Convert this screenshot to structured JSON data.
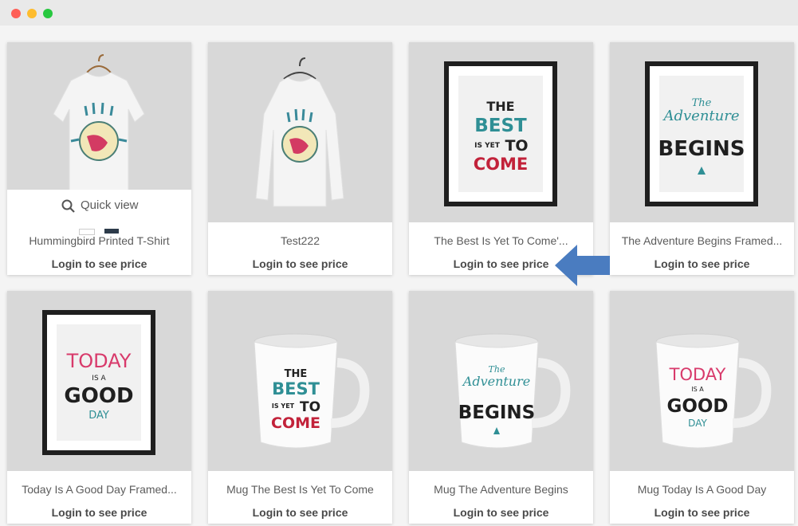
{
  "window": {
    "colors": {
      "close": "#fe5f57",
      "minimize": "#febc2e",
      "maximize": "#28c840"
    }
  },
  "quick_view": {
    "label": "Quick view",
    "icon": "search-icon"
  },
  "products": [
    {
      "name": "Hummingbird Printed T-Shirt",
      "price": "Login to see price",
      "image": "tshirt-hummingbird"
    },
    {
      "name": "Test222",
      "price": "Login to see price",
      "image": "sweater-hummingbird"
    },
    {
      "name": "The Best Is Yet To Come'...",
      "price": "Login to see price",
      "image": "poster-best-is-yet-to-come"
    },
    {
      "name": "The Adventure Begins Framed...",
      "price": "Login to see price",
      "image": "poster-adventure-begins"
    },
    {
      "name": "Today Is A Good Day Framed...",
      "price": "Login to see price",
      "image": "poster-today-good-day"
    },
    {
      "name": "Mug The Best Is Yet To Come",
      "price": "Login to see price",
      "image": "mug-best-is-yet-to-come"
    },
    {
      "name": "Mug The Adventure Begins",
      "price": "Login to see price",
      "image": "mug-adventure-begins"
    },
    {
      "name": "Mug Today Is A Good Day",
      "price": "Login to see price",
      "image": "mug-today-good-day"
    }
  ],
  "artwork": {
    "best": {
      "the": "THE",
      "best": "BEST",
      "is_yet": "IS YET",
      "to": "TO",
      "come": "COME"
    },
    "adventure": {
      "the": "The",
      "adventure": "Adventure",
      "begins": "BEGINS"
    },
    "today": {
      "today": "TODAY",
      "is_a": "IS A",
      "good": "GOOD",
      "day": "DAY"
    }
  },
  "annotation": {
    "icon": "arrow-left-icon",
    "color": "#4a7cc0"
  },
  "colors": {
    "teal": "#2f8f95",
    "red": "#c2223a",
    "pink": "#d83a6b",
    "dark": "#1f1f1f"
  }
}
